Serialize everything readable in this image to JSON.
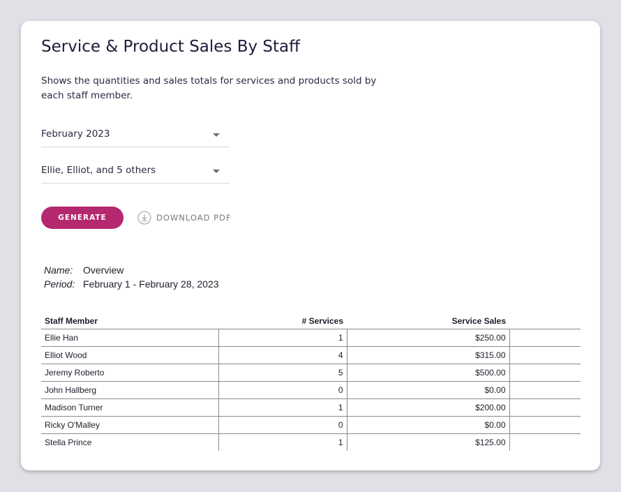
{
  "title": "Service & Product Sales By Staff",
  "description": "Shows the quantities and sales totals for services and products sold by each staff member.",
  "filters": {
    "period": "February 2023",
    "staff": "Ellie, Elliot, and 5 others"
  },
  "actions": {
    "generate": "GENERATE",
    "download": "DOWNLOAD PDF"
  },
  "report": {
    "name_label": "Name:",
    "name": "Overview",
    "period_label": "Period:",
    "period": "February 1 - February 28, 2023"
  },
  "table": {
    "headers": [
      "Staff Member",
      "# Services",
      "Service Sales",
      ""
    ],
    "rows": [
      [
        "Ellie Han",
        "1",
        "$250.00"
      ],
      [
        "Elliot Wood",
        "4",
        "$315.00"
      ],
      [
        "Jeremy Roberto",
        "5",
        "$500.00"
      ],
      [
        "John Hallberg",
        "0",
        "$0.00"
      ],
      [
        "Madison Turner",
        "1",
        "$200.00"
      ],
      [
        "Ricky O'Malley",
        "0",
        "$0.00"
      ],
      [
        "Stella Prince",
        "1",
        "$125.00"
      ]
    ]
  },
  "colors": {
    "accent": "#b4286f",
    "background": "#e1e0e6"
  }
}
